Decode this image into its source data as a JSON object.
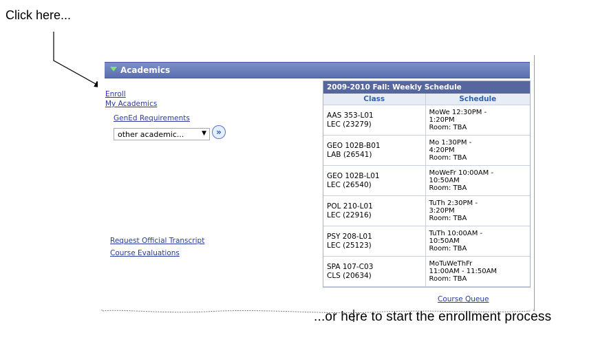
{
  "annotations": {
    "top": "Click here...",
    "bottom": "...or here to start the enrollment process"
  },
  "panel": {
    "title": "Academics",
    "links": {
      "enroll": "Enroll",
      "my_academics": "My Academics",
      "gened": "GenEd Requirements",
      "transcript": "Request Official Transcript",
      "evaluations": "Course Evaluations",
      "course_queue": "Course Queue"
    },
    "dropdown_value": "other academic...",
    "go_icon": "double-chevron-right-icon"
  },
  "schedule": {
    "title": "2009-2010 Fall: Weekly Schedule",
    "col_class": "Class",
    "col_schedule": "Schedule",
    "rows": [
      {
        "class_line1": "AAS 353-L01",
        "class_line2": "LEC (23279)",
        "sched1": "MoWe 12:30PM -",
        "sched2": "1:20PM",
        "sched3": "Room:  TBA"
      },
      {
        "class_line1": "GEO 102B-B01",
        "class_line2": "LAB (26541)",
        "sched1": "Mo 1:30PM -",
        "sched2": "4:20PM",
        "sched3": "Room:  TBA"
      },
      {
        "class_line1": "GEO 102B-L01",
        "class_line2": "LEC (26540)",
        "sched1": "MoWeFr 10:00AM -",
        "sched2": "10:50AM",
        "sched3": "Room:  TBA"
      },
      {
        "class_line1": "POL 210-L01",
        "class_line2": "LEC (22916)",
        "sched1": "TuTh 2:30PM -",
        "sched2": "3:20PM",
        "sched3": "Room:  TBA"
      },
      {
        "class_line1": "PSY 208-L01",
        "class_line2": "LEC (25123)",
        "sched1": "TuTh 10:00AM -",
        "sched2": "10:50AM",
        "sched3": "Room:  TBA"
      },
      {
        "class_line1": "SPA 107-C03",
        "class_line2": "CLS (20634)",
        "sched1": "MoTuWeThFr",
        "sched2": "11:00AM - 11:50AM",
        "sched3": "Room:  TBA"
      }
    ]
  },
  "colors": {
    "header": "#5a6fb0",
    "link": "#2a3aa0",
    "accent_triangle": "#7fe07f"
  }
}
